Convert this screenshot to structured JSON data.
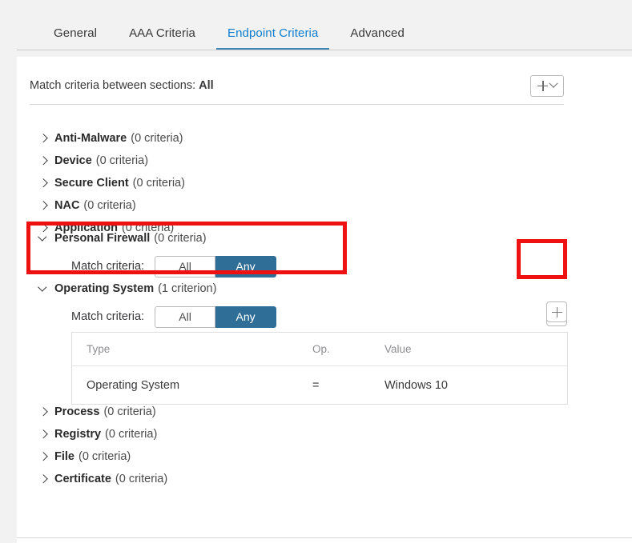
{
  "tabs": [
    {
      "label": "General",
      "active": false
    },
    {
      "label": "AAA Criteria",
      "active": false
    },
    {
      "label": "Endpoint Criteria",
      "active": true
    },
    {
      "label": "Advanced",
      "active": false
    }
  ],
  "match_between": {
    "label": "Match criteria between sections:",
    "value": "All",
    "add_button_label": "+"
  },
  "sections": [
    {
      "name": "Anti-Malware",
      "count": "(0 criteria)",
      "expanded": false
    },
    {
      "name": "Device",
      "count": "(0 criteria)",
      "expanded": false
    },
    {
      "name": "Secure Client",
      "count": "(0 criteria)",
      "expanded": false
    },
    {
      "name": "NAC",
      "count": "(0 criteria)",
      "expanded": false
    },
    {
      "name": "Application",
      "count": "(0 criteria)",
      "expanded": false
    },
    {
      "name": "Personal Firewall",
      "count": "(0 criteria)",
      "expanded": true
    },
    {
      "name": "Operating System",
      "count": "(1 criterion)",
      "expanded": true
    },
    {
      "name": "Process",
      "count": "(0 criteria)",
      "expanded": false
    },
    {
      "name": "Registry",
      "count": "(0 criteria)",
      "expanded": false
    },
    {
      "name": "File",
      "count": "(0 criteria)",
      "expanded": false
    },
    {
      "name": "Certificate",
      "count": "(0 criteria)",
      "expanded": false
    }
  ],
  "firewall_section": {
    "criteria_label": "Match criteria:",
    "option_all": "All",
    "option_any": "Any",
    "selected": "Any",
    "add_button_label": "+"
  },
  "os_section": {
    "criteria_label": "Match criteria:",
    "option_all": "All",
    "option_any": "Any",
    "selected": "Any",
    "add_button_label": "+"
  },
  "criteria_table": {
    "headers": {
      "type": "Type",
      "op": "Op.",
      "value": "Value"
    },
    "rows": [
      {
        "type": "Operating System",
        "op": "=",
        "value": "Windows 10"
      }
    ]
  },
  "colors": {
    "accent_blue": "#0d7ecf",
    "toggle_blue": "#2f6e96",
    "highlight_red": "#ef1111",
    "page_gray": "#f2f2f2"
  }
}
